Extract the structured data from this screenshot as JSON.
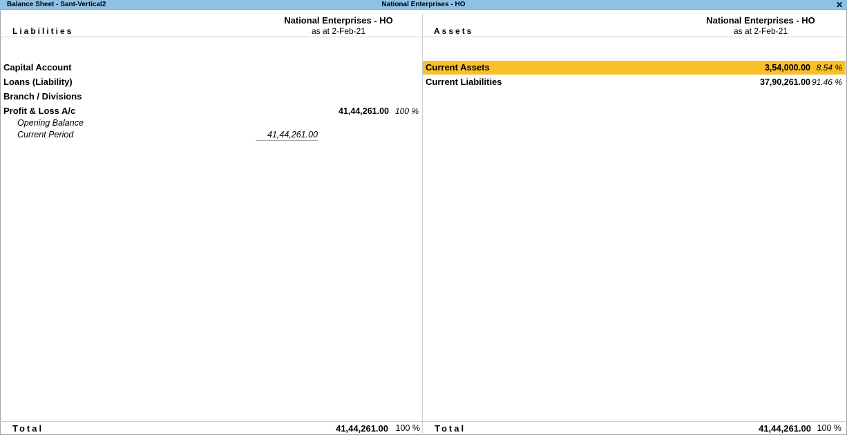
{
  "window": {
    "title": "Balance Sheet - Sant-Vertical2",
    "center_title": "National Enterprises - HO",
    "close_glyph": "✕"
  },
  "liabilities": {
    "label": "Liabilities",
    "company": "National Enterprises - HO",
    "as_at": "as at 2-Feb-21",
    "rows": [
      {
        "name": "Capital Account",
        "amount": "",
        "pct": ""
      },
      {
        "name": "Loans (Liability)",
        "amount": "",
        "pct": ""
      },
      {
        "name": "Branch / Divisions",
        "amount": "",
        "pct": ""
      },
      {
        "name": "Profit & Loss A/c",
        "amount": "41,44,261.00",
        "pct": "100 %"
      }
    ],
    "sub_rows": [
      {
        "name": "Opening Balance",
        "amount": ""
      },
      {
        "name": "Current Period",
        "amount": "41,44,261.00"
      }
    ],
    "total": {
      "label": "Total",
      "amount": "41,44,261.00",
      "pct": "100 %"
    }
  },
  "assets": {
    "label": "Assets",
    "company": "National Enterprises - HO",
    "as_at": "as at 2-Feb-21",
    "rows": [
      {
        "name": "Current Assets",
        "amount": "3,54,000.00",
        "pct": "8.54 %"
      },
      {
        "name": "Current Liabilities",
        "amount": "37,90,261.00",
        "pct": "91.46 %"
      }
    ],
    "total": {
      "label": "Total",
      "amount": "41,44,261.00",
      "pct": "100 %"
    }
  },
  "colors": {
    "titlebar": "#8ec1e6",
    "selection": "#fbbf2b"
  }
}
